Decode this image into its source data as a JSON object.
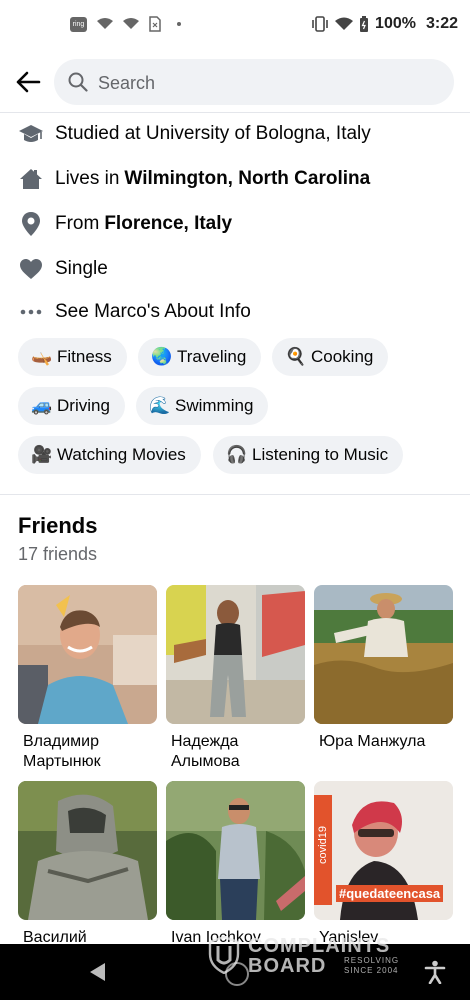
{
  "status_bar": {
    "notification_icons": [
      "ring-icon",
      "wifi-icon",
      "wifi-icon",
      "sim-icon",
      "dot-icon"
    ],
    "ring_label": "ring",
    "battery": "100%",
    "time": "3:22"
  },
  "header": {
    "search_placeholder": "Search"
  },
  "about": {
    "studied": "Studied at University of Bologna, Italy",
    "lives_prefix": "Lives in",
    "lives_place": "Wilmington, North Carolina",
    "from_prefix": "From",
    "from_place": "Florence, Italy",
    "relationship": "Single",
    "see_about": "See Marco's About Info"
  },
  "hobbies": [
    {
      "emoji": "🛶",
      "label": "Fitness"
    },
    {
      "emoji": "🌏",
      "label": "Traveling"
    },
    {
      "emoji": "🍳",
      "label": "Cooking"
    },
    {
      "emoji": "🚙",
      "label": "Driving"
    },
    {
      "emoji": "🌊",
      "label": "Swimming"
    },
    {
      "emoji": "🎥",
      "label": "Watching Movies"
    },
    {
      "emoji": "🎧",
      "label": "Listening to Music"
    }
  ],
  "friends": {
    "title": "Friends",
    "count": "17 friends",
    "list": [
      {
        "name": "Владимир Мартынюк"
      },
      {
        "name": "Надежда Алымова"
      },
      {
        "name": "Юра Манжула"
      },
      {
        "name": "Василий"
      },
      {
        "name": "Ivan Iochkov"
      },
      {
        "name": "Yanislev"
      }
    ],
    "photo_texts": {
      "covid": "covid19",
      "hashtag": "#quedateencasa"
    }
  },
  "watermark": {
    "line1": "COMPLAINTS",
    "line2": "BOARD",
    "tagline1": "RESOLVING",
    "tagline2": "SINCE 2004"
  },
  "colors": {
    "chip_bg": "#f0f2f5",
    "secondary_text": "#65676b",
    "icon_gray": "#606770"
  }
}
